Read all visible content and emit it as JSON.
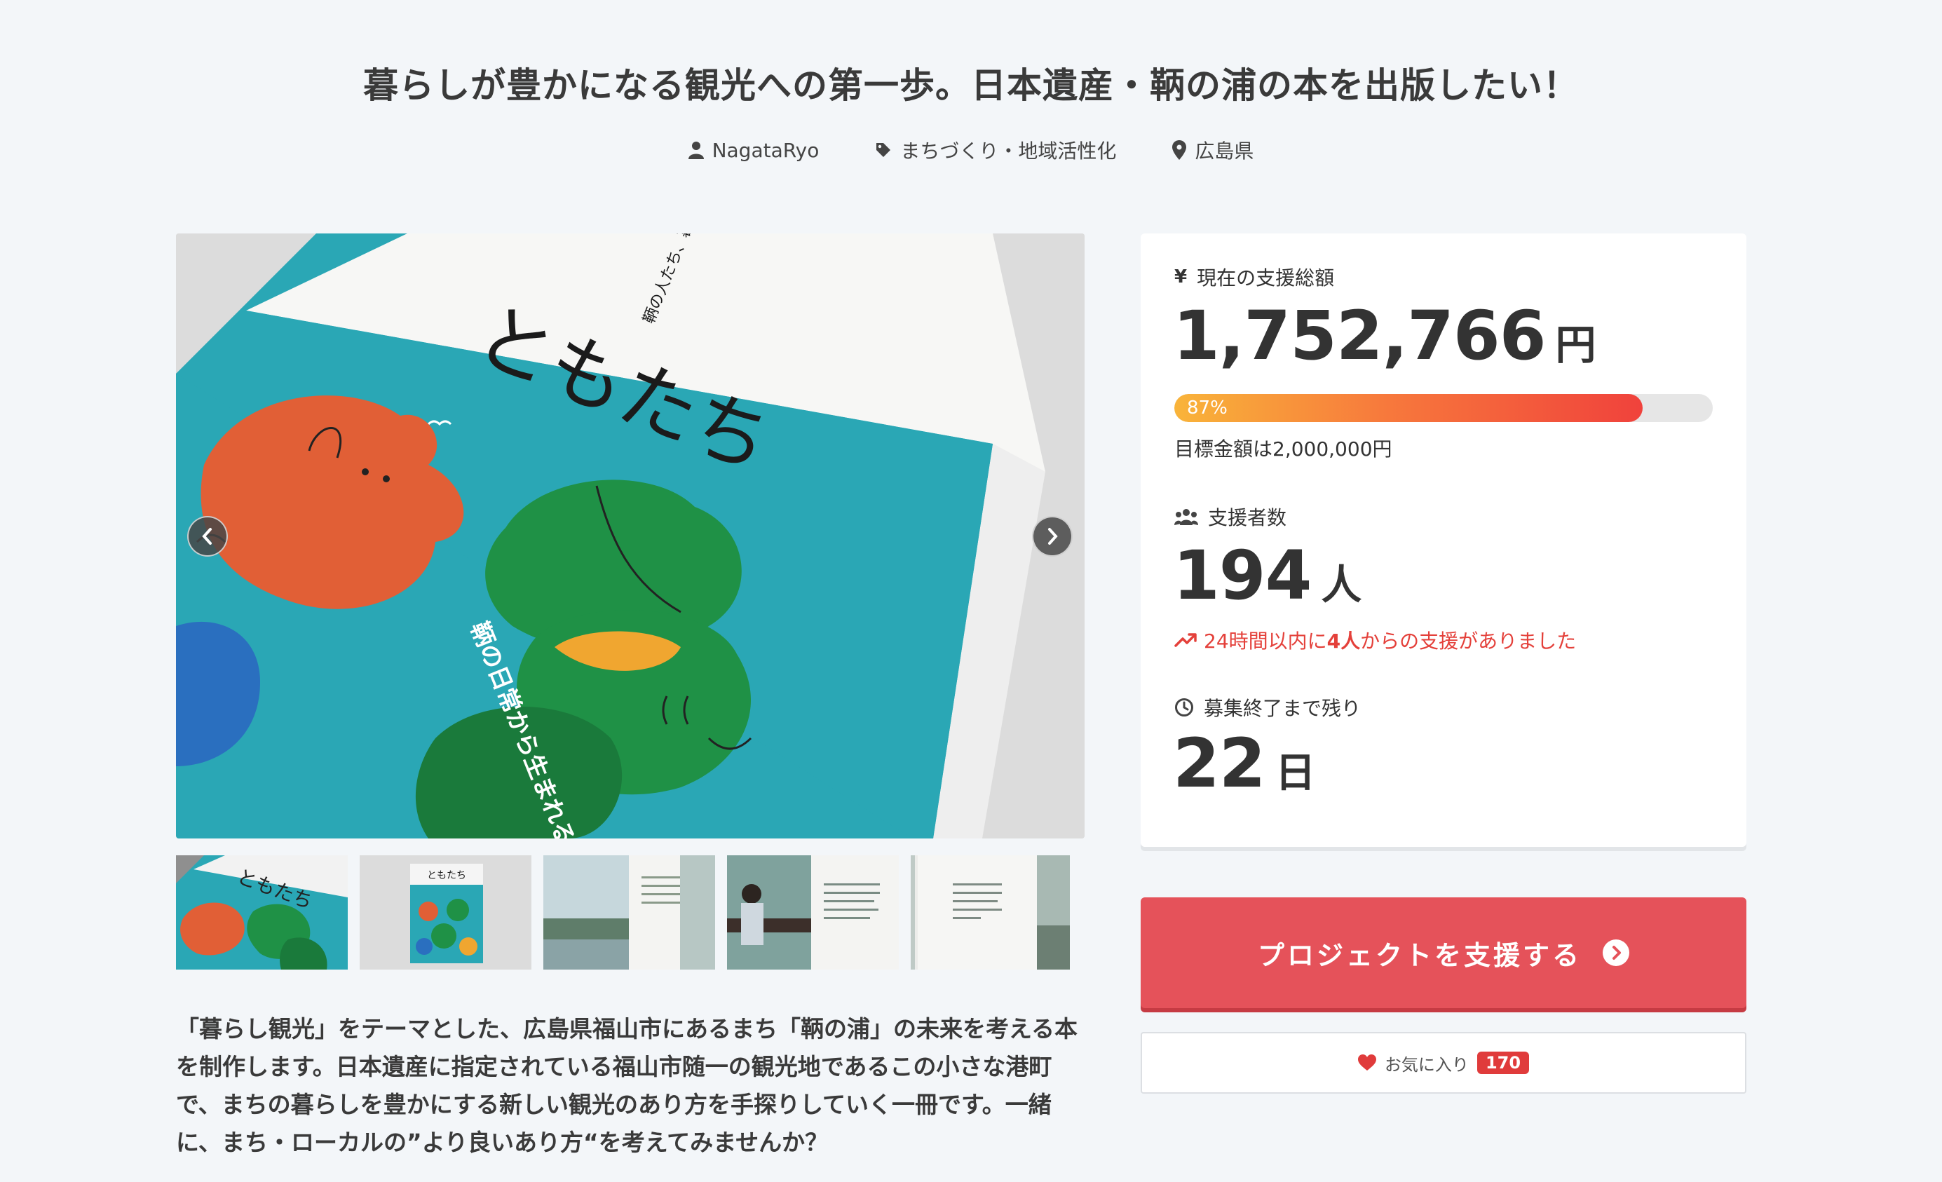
{
  "project": {
    "title": "暮らしが豊かになる観光への第一歩。日本遺産・鞆の浦の本を出版したい！",
    "owner": "NagataRyo",
    "category": "まちづくり・地域活性化",
    "location": "広島県"
  },
  "gallery": {
    "book_title": "ともたち",
    "book_tagline": "鞆の人たち、暮らしたち。",
    "book_subtitle": "鞆の日常から生まれる暮らし観光。",
    "thumb_book_title": "ともたち",
    "icons": {
      "prev": "chevron-left-icon",
      "next": "chevron-right-icon"
    }
  },
  "description": "「暮らし観光」をテーマとした、広島県福山市にあるまち「鞆の浦」の未来を考える本を制作します。日本遺産に指定されている福山市随一の観光地であるこの小さな港町で、まちの暮らしを豊かにする新しい観光のあり方を手探りしていく一冊です。一緒に、まち・ローカルの”より良いあり方“を考えてみませんか？",
  "stats": {
    "funding_label": "現在の支援総額",
    "funding_amount": "1,752,766",
    "funding_unit": "円",
    "progress_percent": 87,
    "progress_label": "87%",
    "target_text": "目標金額は2,000,000円",
    "supporters_label": "支援者数",
    "supporters_count": "194",
    "supporters_unit": "人",
    "recent_prefix": "24時間以内に",
    "recent_count": "4人",
    "recent_suffix": "からの支援がありました",
    "remaining_label": "募集終了まで残り",
    "remaining_days": "22",
    "remaining_unit": "日"
  },
  "actions": {
    "support_button": "プロジェクトを支援する",
    "favorite_label": "お気に入り",
    "favorite_count": "170"
  },
  "colors": {
    "accent": "#e5525a",
    "recent_text": "#e4403a",
    "progress_start": "#f9b43a",
    "progress_end": "#f0423c",
    "badge": "#e03b3b"
  }
}
